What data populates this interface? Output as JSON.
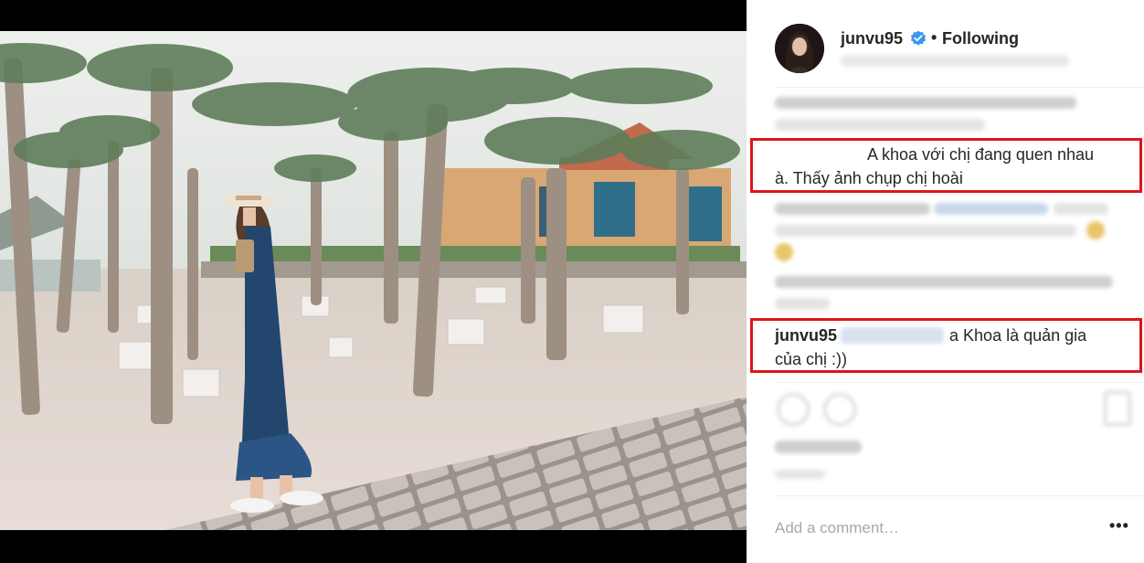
{
  "post": {
    "username": "junvu95",
    "follow_label": "Following",
    "separator": "•"
  },
  "comments": {
    "highlighted_1": {
      "line1": "A khoa với chị đang quen nhau",
      "line2": "à. Thấy ảnh chụp chị hoài"
    },
    "highlighted_2": {
      "user": "junvu95",
      "text": "a Khoa là quản gia",
      "line2": "của chị :))"
    }
  },
  "composer": {
    "placeholder": "Add a comment…",
    "more_label": "•••"
  },
  "colors": {
    "highlight": "#e0141b",
    "verified": "#3897f0",
    "text": "#262626"
  },
  "icons": [
    "verified-badge-icon",
    "heart-icon",
    "comment-icon",
    "bookmark-icon",
    "more-options-icon"
  ]
}
